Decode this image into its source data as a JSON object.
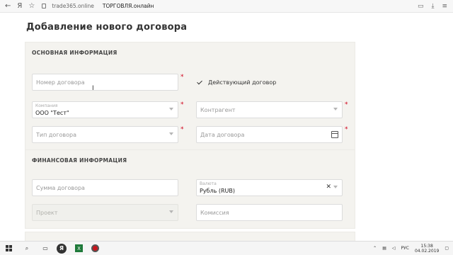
{
  "browser": {
    "back": "←",
    "yandex": "Я",
    "star": "☆",
    "domain": "trade365.online",
    "title": "ТОРГОВЛЯ.онлайн",
    "icons": [
      "bookmark-icon",
      "download-icon",
      "menu-icon"
    ]
  },
  "page": {
    "title": "Добавление нового договора"
  },
  "basic": {
    "heading": "ОСНОВНАЯ ИНФОРМАЦИЯ",
    "contract_number_placeholder": "Номер договора",
    "active_contract_label": "Действующий договор",
    "company_label": "Компания",
    "company_value": "ООО \"Тест\"",
    "counterparty_placeholder": "Контрагент",
    "contract_type_placeholder": "Тип договора",
    "contract_date_placeholder": "Дата договора"
  },
  "finance": {
    "heading": "ФИНАНСОВАЯ ИНФОРМАЦИЯ",
    "amount_placeholder": "Сумма договора",
    "currency_label": "Валюта",
    "currency_value": "Рубль (RUB)",
    "project_placeholder": "Проект",
    "commission_placeholder": "Комиссия"
  },
  "taskbar": {
    "lang": "РУС",
    "time": "15:38",
    "date": "04.02.2019"
  },
  "colors": {
    "required": "#d0021b",
    "card_bg": "#f4f3ef"
  }
}
